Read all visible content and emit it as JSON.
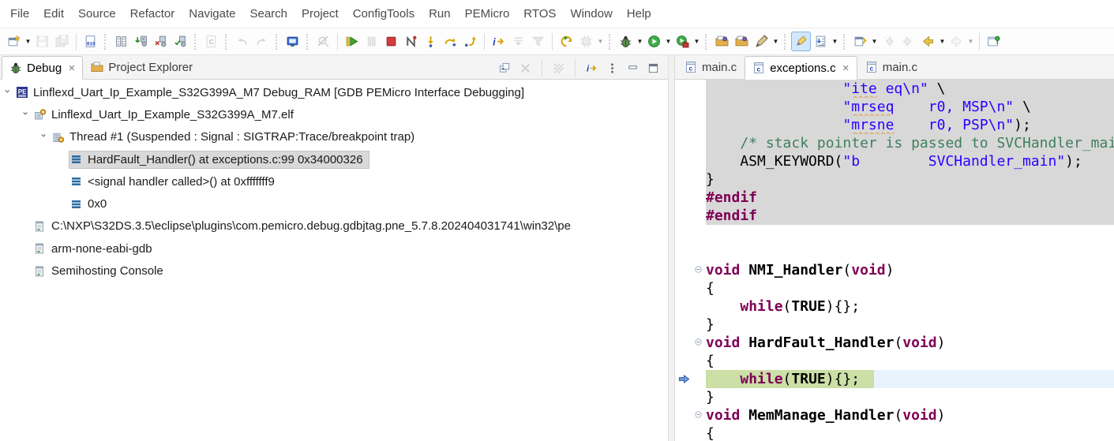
{
  "colors": {
    "keyword": "#7f0055",
    "string": "#2a00ff",
    "comment": "#3f7f5f",
    "inactive_bg": "#d8d8d8",
    "current_line_bg": "#e9f3fd",
    "exec_highlight": "#cbdfa6",
    "selection_bg": "#d9d9d9",
    "accent_blue": "#3c72c8"
  },
  "menu": {
    "items": [
      "File",
      "Edit",
      "Source",
      "Refactor",
      "Navigate",
      "Search",
      "Project",
      "ConfigTools",
      "Run",
      "PEMicro",
      "RTOS",
      "Window",
      "Help"
    ]
  },
  "main_toolbar": {
    "items": [
      {
        "name": "new-wizard-button",
        "icon": "new-wizard-icon",
        "dropdown": true
      },
      {
        "name": "save-button",
        "icon": "save-icon",
        "disabled": true
      },
      {
        "name": "save-all-button",
        "icon": "save-all-icon",
        "disabled": true
      },
      {
        "type": "sep"
      },
      {
        "name": "binary-file-button",
        "icon": "binary-file-icon"
      },
      {
        "type": "dotsep"
      },
      {
        "name": "memory-view-button",
        "icon": "memory-grid-icon"
      },
      {
        "name": "flash-download-button",
        "icon": "flash-download-icon"
      },
      {
        "name": "flash-erase-button",
        "icon": "flash-erase-icon"
      },
      {
        "name": "flash-verify-button",
        "icon": "flash-verify-icon"
      },
      {
        "type": "dotsep"
      },
      {
        "name": "c-file-button",
        "icon": "c-file-icon",
        "disabled": true
      },
      {
        "type": "dotsep"
      },
      {
        "name": "undo-button",
        "icon": "undo-icon",
        "disabled": true
      },
      {
        "name": "redo-button",
        "icon": "redo-icon",
        "disabled": true
      },
      {
        "type": "dotsep"
      },
      {
        "name": "console-button",
        "icon": "console-icon"
      },
      {
        "type": "dotsep"
      },
      {
        "name": "search-button",
        "icon": "search-off-icon",
        "disabled": true
      },
      {
        "type": "sep"
      },
      {
        "name": "resume-button",
        "icon": "resume-icon"
      },
      {
        "name": "suspend-button",
        "icon": "suspend-icon",
        "disabled": true
      },
      {
        "name": "terminate-button",
        "icon": "terminate-icon"
      },
      {
        "name": "disconnect-button",
        "icon": "disconnect-icon"
      },
      {
        "name": "step-into-button",
        "icon": "step-into-icon"
      },
      {
        "name": "step-over-button",
        "icon": "step-over-icon"
      },
      {
        "name": "step-return-button",
        "icon": "step-return-icon"
      },
      {
        "type": "sep"
      },
      {
        "name": "instruction-stepping-button",
        "icon": "instruction-stepping-icon"
      },
      {
        "name": "drop-to-frame-button",
        "icon": "drop-to-frame-icon",
        "disabled": true
      },
      {
        "name": "use-step-filters-button",
        "icon": "step-filters-icon",
        "disabled": true
      },
      {
        "type": "sep"
      },
      {
        "name": "restart-button",
        "icon": "restart-icon"
      },
      {
        "name": "multicore-button",
        "icon": "chip-icon",
        "disabled": true,
        "dropdown": true
      },
      {
        "type": "dotsep"
      },
      {
        "name": "debug-button",
        "icon": "debug-bug-icon",
        "dropdown": true
      },
      {
        "name": "run-button",
        "icon": "run-icon",
        "dropdown": true
      },
      {
        "name": "run-configurations-button",
        "icon": "run-config-icon",
        "dropdown": true
      },
      {
        "type": "dotsep"
      },
      {
        "name": "open-project-button",
        "icon": "folder-import-icon"
      },
      {
        "name": "import-example-button",
        "icon": "folder-import-icon"
      },
      {
        "name": "external-tools-button",
        "icon": "external-tools-icon",
        "dropdown": true
      },
      {
        "type": "dotsep"
      },
      {
        "name": "mark-occurrences-button",
        "icon": "highlighter-icon",
        "selected": true
      },
      {
        "name": "save-console-log-button",
        "icon": "save-log-icon",
        "dropdown": true
      },
      {
        "type": "dotsep"
      },
      {
        "name": "last-edit-location-button",
        "icon": "annotation-window-icon",
        "dropdown": true
      },
      {
        "name": "previous-annotation-button",
        "icon": "prev-annotation-icon",
        "disabled": true
      },
      {
        "name": "next-annotation-button",
        "icon": "next-annotation-icon",
        "disabled": true
      },
      {
        "name": "back-button",
        "icon": "back-icon",
        "dropdown": true
      },
      {
        "name": "forward-button",
        "icon": "forward-icon",
        "disabled": true,
        "dropdown": true
      },
      {
        "type": "sep"
      },
      {
        "name": "pin-editor-button",
        "icon": "pin-editor-icon"
      }
    ]
  },
  "debug_view": {
    "tabs": [
      {
        "label": "Debug",
        "icon": "debug-bug-icon",
        "active": true,
        "closable": true,
        "name": "tab-debug"
      },
      {
        "label": "Project Explorer",
        "icon": "folder-icon",
        "name": "tab-project-explorer"
      }
    ],
    "toolbar": [
      {
        "name": "collapse-all-button",
        "icon": "collapse-all-icon"
      },
      {
        "name": "remove-all-terminated-button",
        "icon": "remove-all-icon",
        "disabled": true
      },
      {
        "type": "sep"
      },
      {
        "name": "source-lookup-button",
        "icon": "pixel-grid-icon",
        "disabled": true
      },
      {
        "type": "sep"
      },
      {
        "name": "instruction-stepping-toggle",
        "icon": "instruction-stepping-icon"
      },
      {
        "name": "view-menu-button",
        "icon": "view-menu-icon"
      },
      {
        "name": "minimize-button",
        "icon": "minimize-icon"
      },
      {
        "name": "maximize-button",
        "icon": "maximize-icon"
      }
    ],
    "tree": [
      {
        "indent": 0,
        "expanded": true,
        "icon": "pemicro-launch-icon",
        "label": "Linflexd_Uart_Ip_Example_S32G399A_M7 Debug_RAM [GDB PEMicro Interface Debugging]"
      },
      {
        "indent": 1,
        "expanded": true,
        "icon": "elf-icon",
        "label": "Linflexd_Uart_Ip_Example_S32G399A_M7.elf"
      },
      {
        "indent": 2,
        "expanded": true,
        "icon": "thread-icon",
        "label": "Thread #1 (Suspended : Signal : SIGTRAP:Trace/breakpoint trap)"
      },
      {
        "indent": 3,
        "icon": "stack-frame-icon",
        "label": "HardFault_Handler() at exceptions.c:99 0x34000326",
        "selected": true
      },
      {
        "indent": 3,
        "icon": "stack-frame-icon",
        "label": "<signal handler called>() at 0xfffffff9"
      },
      {
        "indent": 3,
        "icon": "stack-frame-icon",
        "label": "0x0"
      },
      {
        "indent": 1,
        "icon": "process-icon",
        "label": "C:\\NXP\\S32DS.3.5\\eclipse\\plugins\\com.pemicro.debug.gdbjtag.pne_5.7.8.202404031741\\win32\\pe"
      },
      {
        "indent": 1,
        "icon": "process-icon",
        "label": "arm-none-eabi-gdb"
      },
      {
        "indent": 1,
        "icon": "process-icon",
        "label": "Semihosting Console"
      }
    ]
  },
  "editor": {
    "tabs": [
      {
        "label": "main.c",
        "icon": "c-file-tab-icon",
        "name": "tab-main-c-1"
      },
      {
        "label": "exceptions.c",
        "icon": "c-file-tab-icon",
        "active": true,
        "closable": true,
        "name": "tab-exceptions-c"
      },
      {
        "label": "main.c",
        "icon": "c-file-tab-icon",
        "name": "tab-main-c-2"
      }
    ],
    "code": {
      "current_line": 17,
      "inactive_region": {
        "from": 1,
        "to": 8
      },
      "fold_lines": [
        11,
        15,
        19
      ],
      "lines": [
        [
          [
            "p",
            "                "
          ],
          [
            "s",
            "\""
          ],
          [
            "sp",
            "ite"
          ],
          [
            "s",
            " eq\\n\""
          ],
          [
            "p",
            " \\"
          ]
        ],
        [
          [
            "p",
            "                "
          ],
          [
            "s",
            "\""
          ],
          [
            "sp",
            "mrseq"
          ],
          [
            "s",
            "    r0, MSP\\n\""
          ],
          [
            "p",
            " \\"
          ]
        ],
        [
          [
            "p",
            "                "
          ],
          [
            "s",
            "\""
          ],
          [
            "sp",
            "mrsne"
          ],
          [
            "s",
            "    r0, PSP\\n\""
          ],
          [
            "p",
            ");"
          ]
        ],
        [
          [
            "p",
            "    "
          ],
          [
            "c",
            "/* stack pointer is passed to SVCHandler_mai"
          ]
        ],
        [
          [
            "p",
            "    ASM_KEYWORD("
          ],
          [
            "s",
            "\"b        SVCHandler_main\""
          ],
          [
            "p",
            ");"
          ]
        ],
        [
          [
            "p",
            "}"
          ]
        ],
        [
          [
            "pp",
            "#endif"
          ]
        ],
        [
          [
            "pp",
            "#endif"
          ]
        ],
        [],
        [],
        [
          [
            "k",
            "void"
          ],
          [
            "p",
            " "
          ],
          [
            "b",
            "NMI_Handler"
          ],
          [
            "p",
            "("
          ],
          [
            "k",
            "void"
          ],
          [
            "p",
            ")"
          ]
        ],
        [
          [
            "p",
            "{"
          ]
        ],
        [
          [
            "p",
            "    "
          ],
          [
            "k",
            "while"
          ],
          [
            "p",
            "("
          ],
          [
            "b",
            "TRUE"
          ],
          [
            "p",
            "){};"
          ]
        ],
        [
          [
            "p",
            "}"
          ]
        ],
        [
          [
            "k",
            "void"
          ],
          [
            "p",
            " "
          ],
          [
            "b",
            "HardFault_Handler"
          ],
          [
            "p",
            "("
          ],
          [
            "k",
            "void"
          ],
          [
            "p",
            ")"
          ]
        ],
        [
          [
            "p",
            "{"
          ]
        ],
        [
          [
            "p",
            "    "
          ],
          [
            "k",
            "while"
          ],
          [
            "p",
            "("
          ],
          [
            "b",
            "TRUE"
          ],
          [
            "p",
            "){};"
          ]
        ],
        [
          [
            "p",
            "}"
          ]
        ],
        [
          [
            "k",
            "void"
          ],
          [
            "p",
            " "
          ],
          [
            "b",
            "MemManage_Handler"
          ],
          [
            "p",
            "("
          ],
          [
            "k",
            "void"
          ],
          [
            "p",
            ")"
          ]
        ],
        [
          [
            "p",
            "{"
          ]
        ]
      ]
    }
  }
}
